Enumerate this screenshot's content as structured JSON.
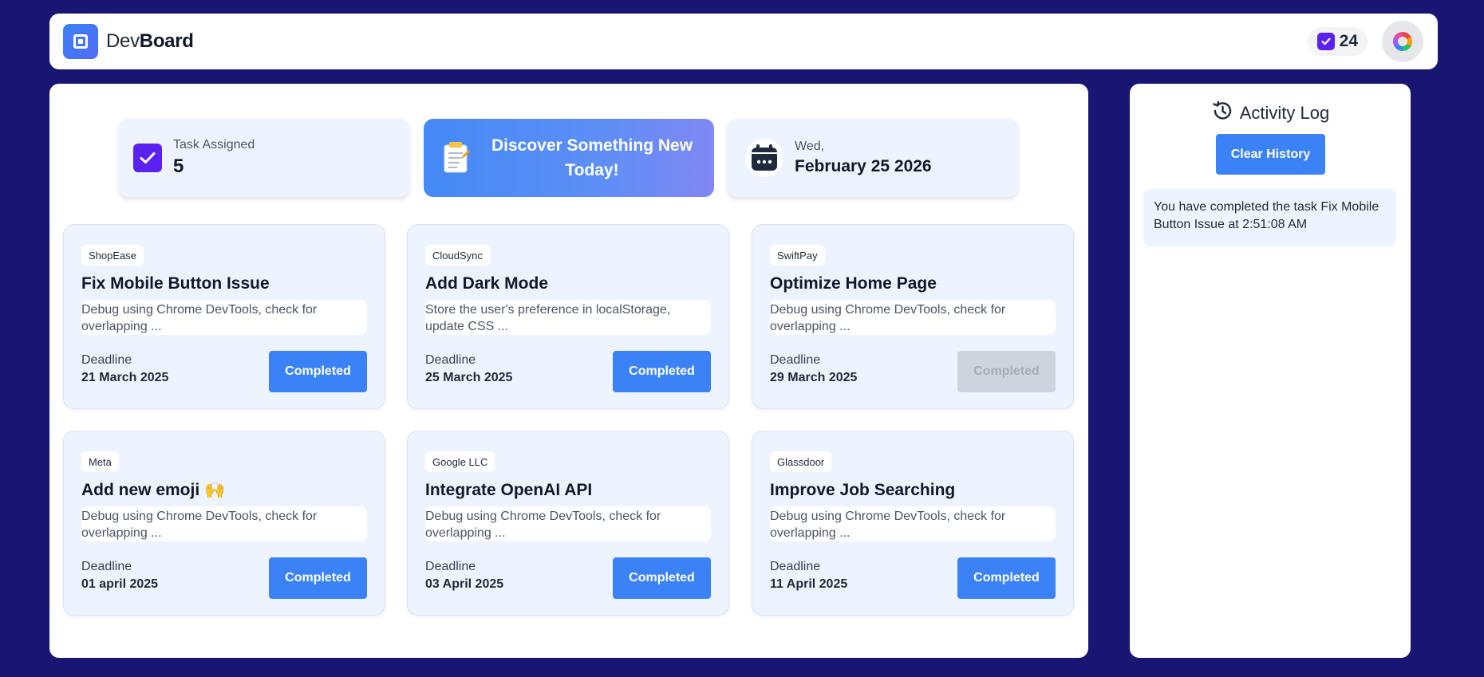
{
  "header": {
    "brand_light": "Dev",
    "brand_bold": "Board",
    "completed_count": "24",
    "icons": {
      "logo": "square-logo-icon",
      "check": "check-icon",
      "avatar": "color-wheel-icon"
    }
  },
  "summary": {
    "task_label": "Task Assigned",
    "task_count": "5",
    "discover_line1": "Discover Something New",
    "discover_line2": "Today!",
    "weekday": "Wed,",
    "date": "February 25 2026"
  },
  "tasks": [
    {
      "company": "ShopEase",
      "title": "Fix Mobile Button Issue",
      "desc": "Debug using Chrome DevTools, check for overlapping ...",
      "deadline_label": "Deadline",
      "deadline": "21 March 2025",
      "button": "Completed",
      "disabled": false
    },
    {
      "company": "CloudSync",
      "title": "Add Dark Mode",
      "desc": "Store the user's preference in localStorage, update CSS ...",
      "deadline_label": "Deadline",
      "deadline": "25 March 2025",
      "button": "Completed",
      "disabled": false
    },
    {
      "company": "SwiftPay",
      "title": "Optimize Home Page",
      "desc": "Debug using Chrome DevTools, check for overlapping ...",
      "deadline_label": "Deadline",
      "deadline": "29 March 2025",
      "button": "Completed",
      "disabled": true
    },
    {
      "company": "Meta",
      "title": "Add new emoji 🙌",
      "desc": "Debug using Chrome DevTools, check for overlapping ...",
      "deadline_label": "Deadline",
      "deadline": "01 april 2025",
      "button": "Completed",
      "disabled": false
    },
    {
      "company": "Google LLC",
      "title": "Integrate OpenAI API",
      "desc": "Debug using Chrome DevTools, check for overlapping ...",
      "deadline_label": "Deadline",
      "deadline": "03 April 2025",
      "button": "Completed",
      "disabled": false
    },
    {
      "company": "Glassdoor",
      "title": "Improve Job Searching",
      "desc": "Debug using Chrome DevTools, check for overlapping ...",
      "deadline_label": "Deadline",
      "deadline": "11 April 2025",
      "button": "Completed",
      "disabled": false
    }
  ],
  "activity": {
    "title": "Activity Log",
    "clear_label": "Clear History",
    "entries": [
      "You have completed the task Fix Mobile Button Issue at 2:51:08 AM"
    ]
  },
  "colors": {
    "background": "#181672",
    "primary": "#3b82f6",
    "check_purple": "#5b21f0",
    "card_bg": "#eef4ff"
  }
}
